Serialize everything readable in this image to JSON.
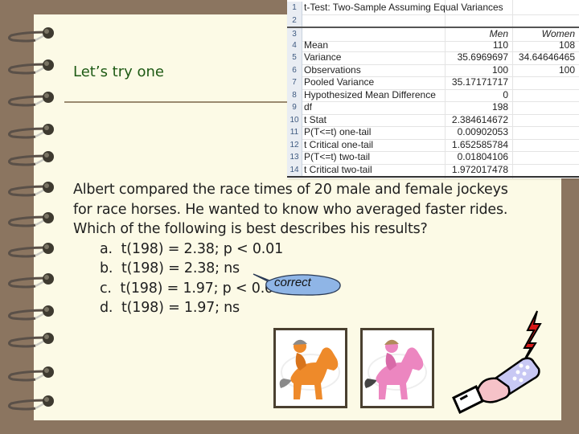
{
  "slide": {
    "title": "Let’s try one",
    "question_lines": [
      "Albert compared the race times of 20 male and female jockeys",
      "for race horses.  He wanted to know who averaged faster rides.",
      "Which of the following is best describes  his results?"
    ],
    "options": [
      {
        "label": "a.",
        "text": "t(198) = 2.38; p < 0.01"
      },
      {
        "label": "b.",
        "text": "t(198) = 2.38; ns"
      },
      {
        "label": "c.",
        "text": "t(198) = 1.97; p < 0.05"
      },
      {
        "label": "d.",
        "text": "t(198) = 1.97; ns"
      }
    ],
    "callout": "correct"
  },
  "spreadsheet": {
    "title": "t-Test: Two-Sample Assuming Equal Variances",
    "columns": [
      "",
      "Men",
      "Women"
    ],
    "rows": [
      {
        "num": "1",
        "label": "t-Test: Two-Sample Assuming Equal Variances",
        "men": "",
        "women": ""
      },
      {
        "num": "2",
        "label": "",
        "men": "",
        "women": ""
      },
      {
        "num": "3",
        "label": "",
        "men": "Men",
        "women": "Women"
      },
      {
        "num": "4",
        "label": "Mean",
        "men": "110",
        "women": "108"
      },
      {
        "num": "5",
        "label": "Variance",
        "men": "35.6969697",
        "women": "34.64646465"
      },
      {
        "num": "6",
        "label": "Observations",
        "men": "100",
        "women": "100"
      },
      {
        "num": "7",
        "label": "Pooled Variance",
        "men": "35.17171717",
        "women": ""
      },
      {
        "num": "8",
        "label": "Hypothesized Mean Difference",
        "men": "0",
        "women": ""
      },
      {
        "num": "9",
        "label": "df",
        "men": "198",
        "women": ""
      },
      {
        "num": "10",
        "label": "t Stat",
        "men": "2.384614672",
        "women": ""
      },
      {
        "num": "11",
        "label": "P(T<=t) one-tail",
        "men": "0.00902053",
        "women": ""
      },
      {
        "num": "12",
        "label": "t Critical one-tail",
        "men": "1.652585784",
        "women": ""
      },
      {
        "num": "13",
        "label": "P(T<=t) two-tail",
        "men": "0.01804106",
        "women": ""
      },
      {
        "num": "14",
        "label": "t Critical two-tail",
        "men": "1.972017478",
        "women": ""
      }
    ]
  },
  "images": {
    "jockey_male": "orange-jockey-on-horse",
    "jockey_female": "pink-jockey-on-horse",
    "remote": "hand-holding-remote-with-signal"
  },
  "colors": {
    "background": "#8b7560",
    "paper": "#fcfae6",
    "title": "#1e5a14",
    "callout_fill": "#8fb5e6"
  }
}
